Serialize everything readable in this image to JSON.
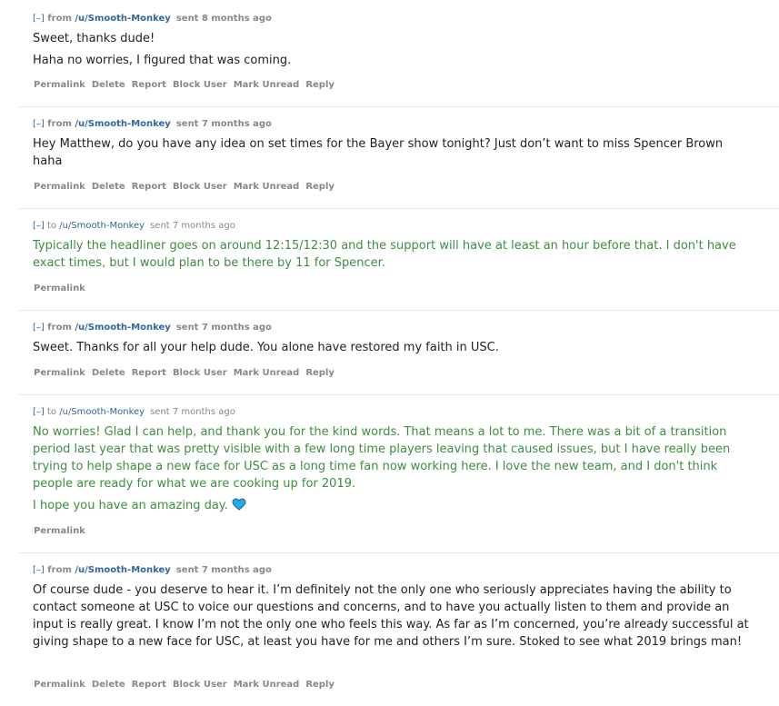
{
  "messages": [
    {
      "toggle": "[–]",
      "direction": "from",
      "user": "/u/Smooth-Monkey",
      "time": "sent 8 months ago",
      "paragraphs": [
        "Sweet, thanks dude!",
        "Haha no worries, I figured that was coming."
      ],
      "actions": [
        "Permalink",
        "Delete",
        "Report",
        "Block User",
        "Mark Unread",
        "Reply"
      ]
    },
    {
      "toggle": "[–]",
      "direction": "from",
      "user": "/u/Smooth-Monkey",
      "time": "sent 7 months ago",
      "paragraphs": [
        "Hey Matthew, do you have any idea on set times for the Bayer show tonight? Just don’t want to miss Spencer Brown haha"
      ],
      "actions": [
        "Permalink",
        "Delete",
        "Report",
        "Block User",
        "Mark Unread",
        "Reply"
      ]
    },
    {
      "toggle": "[–]",
      "direction": "to",
      "user": "/u/Smooth-Monkey",
      "time": "sent 7 months ago",
      "paragraphs": [
        "Typically the headliner goes on around 12:15/12:30 and the support will have at least an hour before that. I don't have exact times, but I would plan to be there by 11 for Spencer."
      ],
      "actions": [
        "Permalink"
      ]
    },
    {
      "toggle": "[–]",
      "direction": "from",
      "user": "/u/Smooth-Monkey",
      "time": "sent 7 months ago",
      "paragraphs": [
        "Sweet. Thanks for all your help dude. You alone have restored my faith in USC."
      ],
      "actions": [
        "Permalink",
        "Delete",
        "Report",
        "Block User",
        "Mark Unread",
        "Reply"
      ]
    },
    {
      "toggle": "[–]",
      "direction": "to",
      "user": "/u/Smooth-Monkey",
      "time": "sent 7 months ago",
      "paragraphs": [
        "No worries! Glad I can help, and thank you for the kind words. That means a lot to me. There was a bit of a transition period last year that was pretty visible with a few long time players leaving that caused issues, but I have really been trying to help shape a new face for USC as a long time fan now working here. I love the new team, and I don't think people are ready for what we are cooking up for 2019.",
        "I hope you have an amazing day."
      ],
      "actions": [
        "Permalink"
      ]
    },
    {
      "toggle": "[–]",
      "direction": "from",
      "user": "/u/Smooth-Monkey",
      "time": "sent 7 months ago",
      "paragraphs": [
        "Of course dude - you deserve to hear it. I’m definitely not the only one who seriously appreciates having the ability to contact someone at USC to voice our questions and concerns, and to have you actually listen to them and provide an input is really great. I know I’m not the only one who feels this way. As far as I’m concerned, you’re already successful at giving shape to a new face for USC, at least you have for me and others I’m sure. Stoked to see what 2019 brings man!"
      ],
      "actions": [
        "Permalink",
        "Delete",
        "Report",
        "Block User",
        "Mark Unread",
        "Reply"
      ]
    }
  ],
  "colors": {
    "link": "#336699",
    "sent_text": "#3e8e3e",
    "meta": "#888888",
    "heart": "#28a9e0"
  },
  "icons": {
    "heart": "blue-heart-emoji"
  }
}
